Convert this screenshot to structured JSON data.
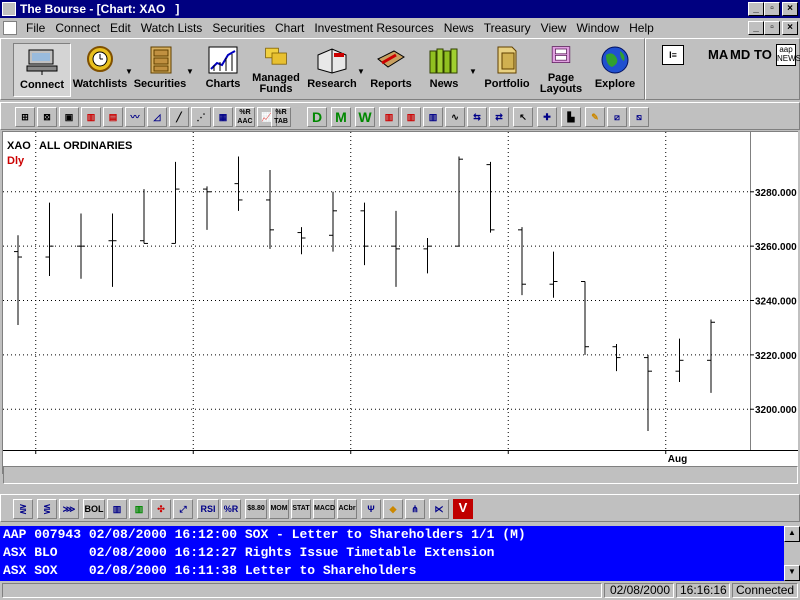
{
  "window": {
    "title": "The Bourse - [Chart: XAO   ]"
  },
  "menu": [
    "File",
    "Connect",
    "Edit",
    "Watch Lists",
    "Securities",
    "Chart",
    "Investment Resources",
    "News",
    "Treasury",
    "View",
    "Window",
    "Help"
  ],
  "toolbar": {
    "connect": "Connect",
    "watchlists": "Watchlists",
    "securities": "Securities",
    "charts": "Charts",
    "managed_funds": "Managed Funds",
    "research": "Research",
    "reports": "Reports",
    "news": "News",
    "portfolio": "Portfolio",
    "page_layouts": "Page Layouts",
    "explore": "Explore"
  },
  "right_toolbar": {
    "ma": "MA",
    "md": "MD",
    "to": "TO",
    "aap": "aap NEWS"
  },
  "chart_toolbar": {
    "period_buttons": [
      "D",
      "M",
      "W"
    ],
    "icon_labels": [
      "%R AAC",
      "%R TAB"
    ]
  },
  "indicator_toolbar": {
    "labels": [
      "BOL",
      "RSI",
      "%R",
      "$8.80",
      "MOM",
      "STAT",
      "MACD",
      "ACbr",
      "V"
    ]
  },
  "chart_data": {
    "type": "ohlc",
    "symbol": "XAO",
    "name": "ALL ORDINARIES",
    "period": "Dly",
    "ylim": [
      3185,
      3302
    ],
    "yticks": [
      "3200.000",
      "3220.000",
      "3240.000",
      "3260.000",
      "3280.000"
    ],
    "ytick_values": [
      3200,
      3220,
      3240,
      3260,
      3280
    ],
    "x_label": "Aug",
    "x_label_bar_index": 21,
    "grid": true,
    "bars": [
      {
        "h": 3264,
        "l": 3231,
        "o": 3258,
        "c": 3256
      },
      {
        "h": 3276,
        "l": 3249,
        "o": 3256,
        "c": 3260
      },
      {
        "h": 3272,
        "l": 3248,
        "o": 3260,
        "c": 3260
      },
      {
        "h": 3272,
        "l": 3245,
        "o": 3262,
        "c": 3262
      },
      {
        "h": 3281,
        "l": 3261,
        "o": 3262,
        "c": 3261
      },
      {
        "h": 3291,
        "l": 3261,
        "o": 3261,
        "c": 3281
      },
      {
        "h": 3282,
        "l": 3266,
        "o": 3281,
        "c": 3280
      },
      {
        "h": 3293,
        "l": 3273,
        "o": 3283,
        "c": 3277
      },
      {
        "h": 3288,
        "l": 3259,
        "o": 3277,
        "c": 3266
      },
      {
        "h": 3267,
        "l": 3257,
        "o": 3265,
        "c": 3263
      },
      {
        "h": 3280,
        "l": 3258,
        "o": 3264,
        "c": 3273
      },
      {
        "h": 3276,
        "l": 3253,
        "o": 3273,
        "c": 3260
      },
      {
        "h": 3273,
        "l": 3245,
        "o": 3260,
        "c": 3259
      },
      {
        "h": 3263,
        "l": 3250,
        "o": 3259,
        "c": 3260
      },
      {
        "h": 3293,
        "l": 3260,
        "o": 3260,
        "c": 3292
      },
      {
        "h": 3291,
        "l": 3265,
        "o": 3290,
        "c": 3266
      },
      {
        "h": 3267,
        "l": 3242,
        "o": 3266,
        "c": 3246
      },
      {
        "h": 3258,
        "l": 3241,
        "o": 3246,
        "c": 3247
      },
      {
        "h": 3247,
        "l": 3220,
        "o": 3247,
        "c": 3223
      },
      {
        "h": 3224,
        "l": 3214,
        "o": 3223,
        "c": 3219
      },
      {
        "h": 3220,
        "l": 3192,
        "o": 3219,
        "c": 3214
      },
      {
        "h": 3226,
        "l": 3210,
        "o": 3214,
        "c": 3218
      },
      {
        "h": 3233,
        "l": 3206,
        "o": 3218,
        "c": 3232
      }
    ]
  },
  "news": [
    "AAP 007943 02/08/2000 16:12:00 SOX - Letter to Shareholders 1/1 (M)",
    "ASX BLO    02/08/2000 16:12:27 Rights Issue Timetable Extension",
    "ASX SOX    02/08/2000 16:11:38 Letter to Shareholders"
  ],
  "status": {
    "date": "02/08/2000",
    "time": "16:16:16",
    "connection": "Connected"
  },
  "colors": {
    "titlebar": "#000080",
    "news_bg": "#0000ff",
    "period_label": "#cc0000",
    "face": "#c0c0c0"
  }
}
